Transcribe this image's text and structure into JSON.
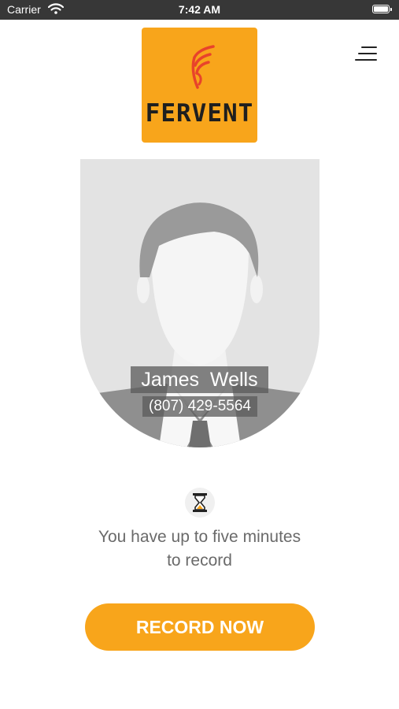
{
  "status_bar": {
    "carrier": "Carrier",
    "time": "7:42 AM"
  },
  "logo": {
    "text": "FERVENT"
  },
  "contact": {
    "name": "James  Wells",
    "phone": "(807) 429-5564"
  },
  "record_info": {
    "line1": "You have up to five minutes",
    "line2": "to record"
  },
  "record_button": {
    "label": "RECORD NOW"
  },
  "colors": {
    "accent": "#f8a51b",
    "status_bar": "#373737",
    "logo_mark": "#e8432b"
  },
  "icons": [
    "wifi-icon",
    "battery-icon",
    "menu-icon",
    "avatar-placeholder",
    "hourglass-icon"
  ]
}
